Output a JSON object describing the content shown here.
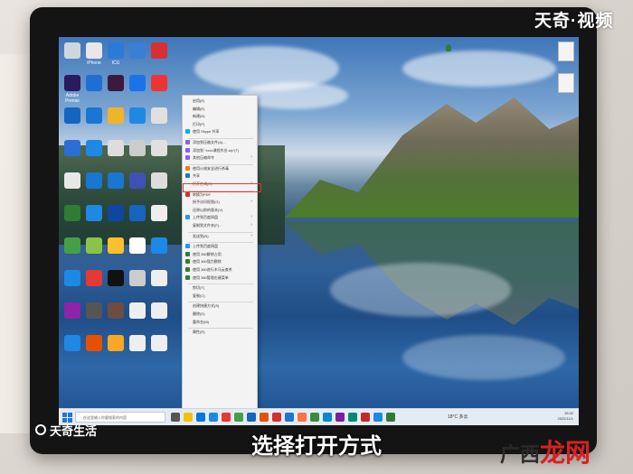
{
  "brand_top": "天奇·视频",
  "brand_bottom": "天奇生活",
  "caption": "选择打开方式",
  "watermark": {
    "part1": "广西",
    "part2": "龙网"
  },
  "context_menu": {
    "items": [
      {
        "label": "启用(E)",
        "icon": "plain",
        "submenu": false
      },
      {
        "label": "编辑(E)",
        "icon": "plain",
        "submenu": false
      },
      {
        "label": "新建(N)",
        "icon": "plain",
        "submenu": false
      },
      {
        "label": "打印(P)",
        "icon": "plain",
        "submenu": false
      },
      {
        "label": "使用 Skype 共享",
        "icon": "skype",
        "submenu": false
      },
      {
        "sep": true
      },
      {
        "label": "添加到压缩文件(A)...",
        "icon": "archive",
        "submenu": false
      },
      {
        "label": "添加到 \"xxxx课程作业.zip\"(T)",
        "icon": "archive",
        "submenu": false
      },
      {
        "label": "其他压缩命令",
        "icon": "archive",
        "submenu": true
      },
      {
        "sep": true
      },
      {
        "label": "使用火绒安全进行杀毒",
        "icon": "shield",
        "submenu": false
      },
      {
        "label": "共享",
        "icon": "share",
        "submenu": false
      },
      {
        "label": "打开方式(H)",
        "icon": "plain",
        "submenu": true,
        "highlight": true
      },
      {
        "sep": true
      },
      {
        "label": "转换为PDF",
        "icon": "pdf",
        "submenu": false
      },
      {
        "label": "授予访问权限(G)",
        "icon": "plain",
        "submenu": true
      },
      {
        "label": "还原以前的版本(V)",
        "icon": "plain",
        "submenu": false
      },
      {
        "label": "上传到百度网盘",
        "icon": "cloud",
        "submenu": true
      },
      {
        "label": "复制到文件夹(F)...",
        "icon": "plain",
        "submenu": true
      },
      {
        "sep": true
      },
      {
        "label": "发送到(N)",
        "icon": "plain",
        "submenu": true
      },
      {
        "sep": true
      },
      {
        "label": "上传到百度网盘",
        "icon": "cloud",
        "submenu": false
      },
      {
        "label": "使用 360解除占用",
        "icon": "360",
        "submenu": false
      },
      {
        "label": "使用 360强力删除",
        "icon": "360",
        "submenu": false
      },
      {
        "label": "使用 360进行木马云查杀",
        "icon": "360",
        "submenu": false
      },
      {
        "label": "使用 360管理右键菜单",
        "icon": "360",
        "submenu": false
      },
      {
        "sep": true
      },
      {
        "label": "剪切(T)",
        "icon": "plain",
        "submenu": false
      },
      {
        "label": "复制(C)",
        "icon": "plain",
        "submenu": false
      },
      {
        "sep": true
      },
      {
        "label": "创建快捷方式(S)",
        "icon": "plain",
        "submenu": false
      },
      {
        "label": "删除(D)",
        "icon": "plain",
        "submenu": false
      },
      {
        "label": "重命名(M)",
        "icon": "plain",
        "submenu": false
      },
      {
        "sep": true
      },
      {
        "label": "属性(R)",
        "icon": "plain",
        "submenu": false
      }
    ]
  },
  "taskbar": {
    "search_placeholder": "在这里输入你要搜索的内容",
    "weather": "18°C 多云",
    "time": "15:42",
    "date": "2022/11/1"
  },
  "desktop_icons": [
    {
      "label": "",
      "color": "#cfd6dd"
    },
    {
      "label": "iPhone",
      "color": "#e8e8e8"
    },
    {
      "label": "ICU",
      "color": "#2b7ad8"
    },
    {
      "label": "",
      "color": "#3b7fd4"
    },
    {
      "label": "",
      "color": "#d83030"
    },
    {
      "label": "Adobe Premie",
      "color": "#2a1a5e"
    },
    {
      "label": "",
      "color": "#1e6ed4"
    },
    {
      "label": "",
      "color": "#3a1a3e"
    },
    {
      "label": "",
      "color": "#1a73e8"
    },
    {
      "label": "",
      "color": "#e33"
    },
    {
      "label": "",
      "color": "#1565c0"
    },
    {
      "label": "",
      "color": "#1976d2"
    },
    {
      "label": "",
      "color": "#f0b429"
    },
    {
      "label": "",
      "color": "#1e88e5"
    },
    {
      "label": "",
      "color": "#e0e0e0"
    },
    {
      "label": "",
      "color": "#2b6fd6"
    },
    {
      "label": "",
      "color": "#1e88e5"
    },
    {
      "label": "",
      "color": "#ddd"
    },
    {
      "label": "",
      "color": "#ccc"
    },
    {
      "label": "",
      "color": "#e0e0e0"
    },
    {
      "label": "",
      "color": "#e8e8e8"
    },
    {
      "label": "",
      "color": "#1976d2"
    },
    {
      "label": "",
      "color": "#1976d2"
    },
    {
      "label": "",
      "color": "#3f51b5"
    },
    {
      "label": "",
      "color": "#ddd"
    },
    {
      "label": "",
      "color": "#2e7d32"
    },
    {
      "label": "",
      "color": "#1e88e5"
    },
    {
      "label": "",
      "color": "#0d47a1"
    },
    {
      "label": "",
      "color": "#1565c0"
    },
    {
      "label": "",
      "color": "#eee"
    },
    {
      "label": "",
      "color": "#43a047"
    },
    {
      "label": "",
      "color": "#8bc34a"
    },
    {
      "label": "",
      "color": "#fbc02d"
    },
    {
      "label": "",
      "color": "#fff"
    },
    {
      "label": "",
      "color": "#1e88e5"
    },
    {
      "label": "",
      "color": "#1e88e5"
    },
    {
      "label": "",
      "color": "#e53935"
    },
    {
      "label": "",
      "color": "#111"
    },
    {
      "label": "",
      "color": "#ccc"
    },
    {
      "label": "",
      "color": "#eee"
    },
    {
      "label": "",
      "color": "#8e24aa"
    },
    {
      "label": "",
      "color": "#555"
    },
    {
      "label": "",
      "color": "#6d4c41"
    },
    {
      "label": "",
      "color": "#eee"
    },
    {
      "label": "",
      "color": "#eee"
    },
    {
      "label": "",
      "color": "#1e88e5"
    },
    {
      "label": "",
      "color": "#e65100"
    },
    {
      "label": "",
      "color": "#f9a825"
    },
    {
      "label": "",
      "color": "#eee"
    },
    {
      "label": "",
      "color": "#eee"
    }
  ],
  "right_icons": [
    {
      "label": ""
    },
    {
      "label": ""
    }
  ],
  "colors": {
    "highlight_border": "#e53935",
    "menu_bg": "#f3f3f3",
    "watermark_red": "#d92020"
  }
}
